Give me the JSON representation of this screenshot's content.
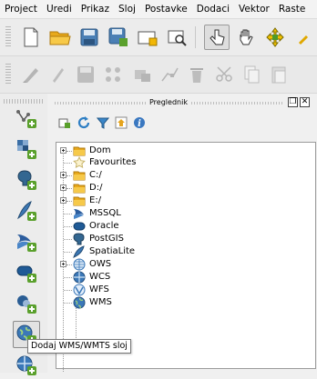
{
  "menu": [
    "Project",
    "Uredi",
    "Prikaz",
    "Sloj",
    "Postavke",
    "Dodaci",
    "Vektor",
    "Raste"
  ],
  "toolbar1": {
    "icons": [
      "new-project-icon",
      "open-project-icon",
      "save-project-icon",
      "save-as-icon",
      "new-print-composer-icon",
      "composer-manager-icon",
      "touch-zoom-icon",
      "pan-icon",
      "pan-to-selection-icon"
    ]
  },
  "toolbar2": {
    "icons": [
      "current-edits-icon",
      "toggle-editing-icon",
      "save-layer-edits-icon",
      "add-feature-icon",
      "move-feature-icon",
      "node-tool-icon",
      "delete-selected-icon",
      "cut-features-icon",
      "copy-features-icon",
      "paste-features-icon"
    ]
  },
  "left_toolbar": {
    "icons": [
      "add-vector-layer-icon",
      "add-raster-layer-icon",
      "add-postgis-layer-icon",
      "add-spatialite-layer-icon",
      "add-mssql-layer-icon",
      "add-oracle-layer-icon",
      "add-db2-layer-icon",
      "add-wms-layer-icon",
      "add-wcs-layer-icon"
    ]
  },
  "browser_panel": {
    "title": "Preglednik",
    "tools": [
      "add-selected-icon",
      "refresh-icon",
      "filter-icon",
      "collapse-all-icon",
      "properties-icon"
    ],
    "items": [
      {
        "label": "Dom",
        "icon": "folder"
      },
      {
        "label": "Favourites",
        "icon": "star"
      },
      {
        "label": "C:/",
        "icon": "folder"
      },
      {
        "label": "D:/",
        "icon": "folder"
      },
      {
        "label": "E:/",
        "icon": "folder"
      },
      {
        "label": "MSSQL",
        "icon": "mssql"
      },
      {
        "label": "Oracle",
        "icon": "oracle"
      },
      {
        "label": "PostGIS",
        "icon": "postgis"
      },
      {
        "label": "SpatiaLite",
        "icon": "spatialite"
      },
      {
        "label": "OWS",
        "icon": "ows"
      },
      {
        "label": "WCS",
        "icon": "wcs"
      },
      {
        "label": "WFS",
        "icon": "wfs"
      },
      {
        "label": "WMS",
        "icon": "wms"
      }
    ]
  },
  "tooltip": "Dodaj WMS/WMTS sloj"
}
